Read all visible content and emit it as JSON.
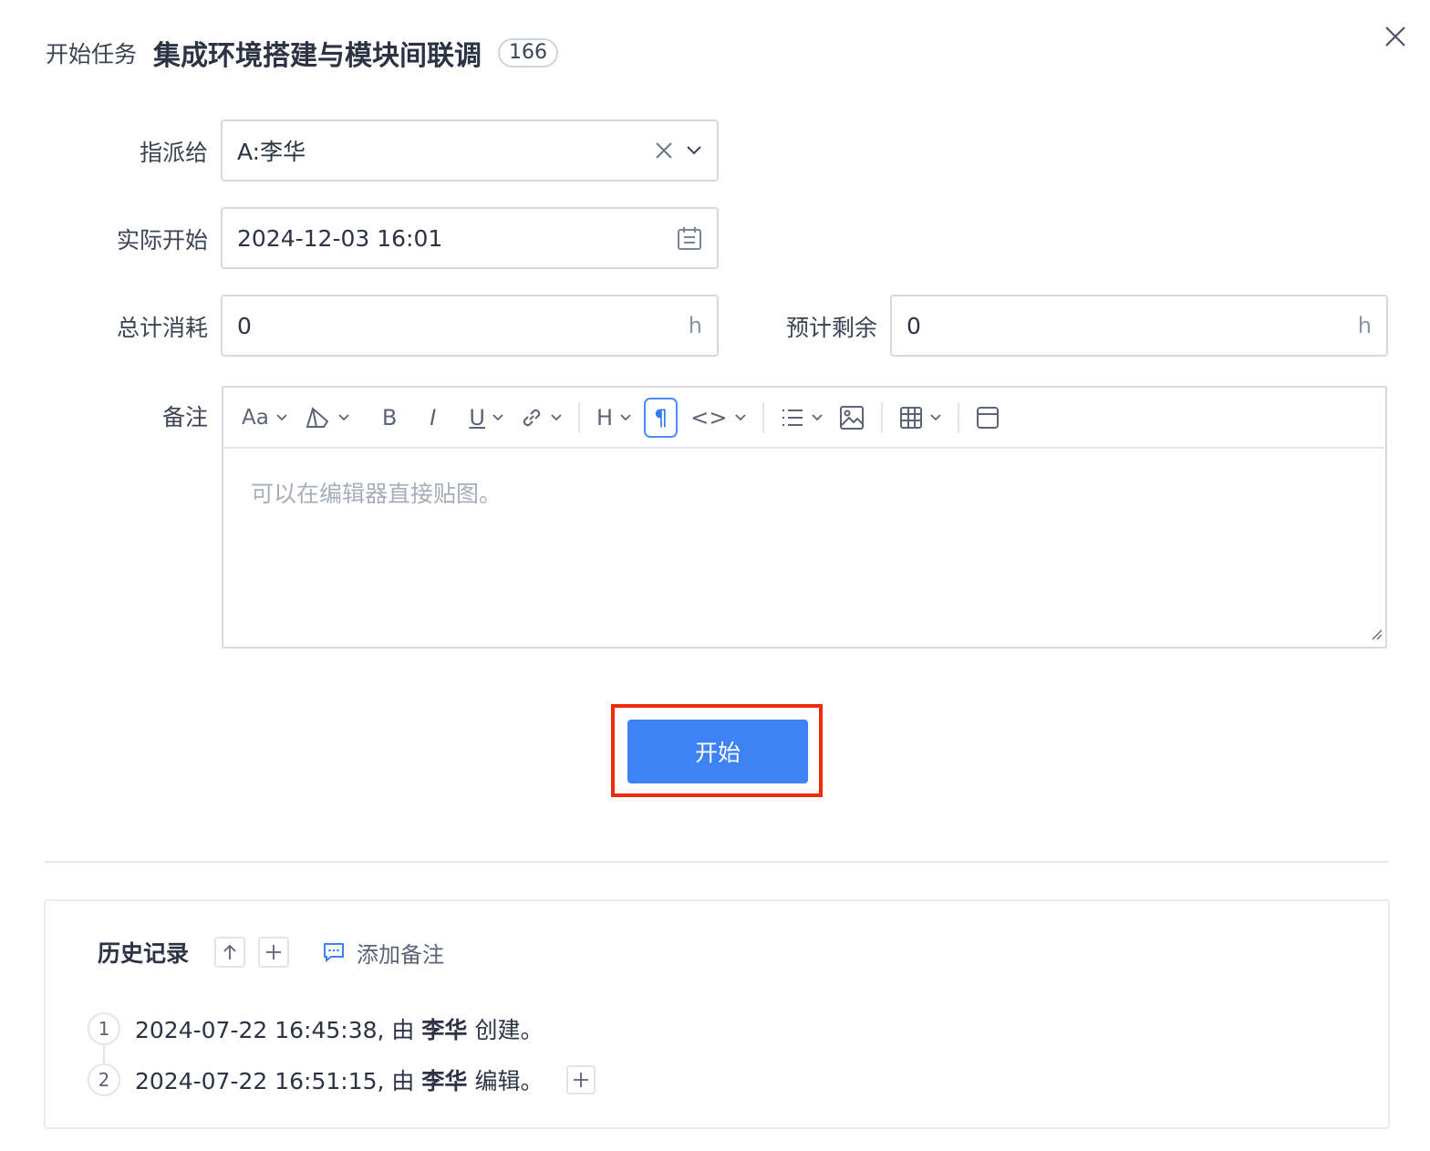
{
  "header": {
    "prefix": "开始任务",
    "title": "集成环境搭建与模块间联调",
    "badge": "166"
  },
  "form": {
    "assign": {
      "label": "指派给",
      "value": "A:李华"
    },
    "actual_start": {
      "label": "实际开始",
      "value": "2024-12-03 16:01"
    },
    "total_consumed": {
      "label": "总计消耗",
      "value": "0",
      "unit": "h"
    },
    "estimate_left": {
      "label": "预计剩余",
      "value": "0",
      "unit": "h"
    },
    "remark": {
      "label": "备注",
      "placeholder": "可以在编辑器直接贴图。"
    }
  },
  "toolbar": {
    "font_size": "Aa",
    "bold": "B",
    "italic": "I",
    "underline": "U",
    "heading": "H",
    "paragraph": "¶",
    "code": "<>"
  },
  "actions": {
    "start_label": "开始"
  },
  "history": {
    "title": "历史记录",
    "add_note": "添加备注",
    "items": [
      {
        "num": "1",
        "time": "2024-07-22 16:45:38, 由",
        "user": "李华",
        "action": "创建。"
      },
      {
        "num": "2",
        "time": "2024-07-22 16:51:15, 由",
        "user": "李华",
        "action": "编辑。"
      }
    ]
  },
  "colors": {
    "primary": "#3d83f5",
    "highlight": "#f02b0c",
    "border": "#d5dbe4"
  }
}
